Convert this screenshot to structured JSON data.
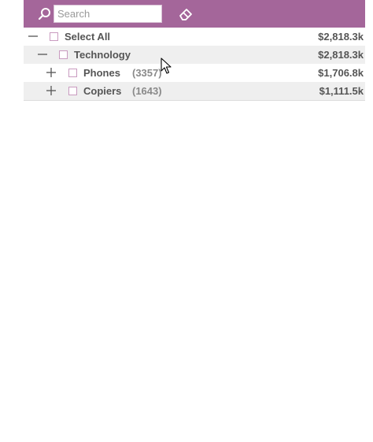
{
  "search": {
    "placeholder": "Search",
    "value": ""
  },
  "toolbar": {
    "search_icon": "search-icon",
    "clear_icon": "eraser-icon"
  },
  "tree": [
    {
      "level": 0,
      "expander": "collapse",
      "label": "Select All",
      "count": "",
      "value": "$2,818.3k"
    },
    {
      "level": 1,
      "expander": "collapse",
      "label": "Technology",
      "count": "",
      "value": "$2,818.3k"
    },
    {
      "level": 2,
      "expander": "expand",
      "label": "Phones",
      "count": "(3357)",
      "value": "$1,706.8k"
    },
    {
      "level": 2,
      "expander": "expand",
      "label": "Copiers",
      "count": "(1643)",
      "value": "$1,111.5k"
    }
  ],
  "colors": {
    "toolbar": "#a4669a",
    "checkbox_border": "#c99bc0",
    "row_shade": "#efefef"
  }
}
